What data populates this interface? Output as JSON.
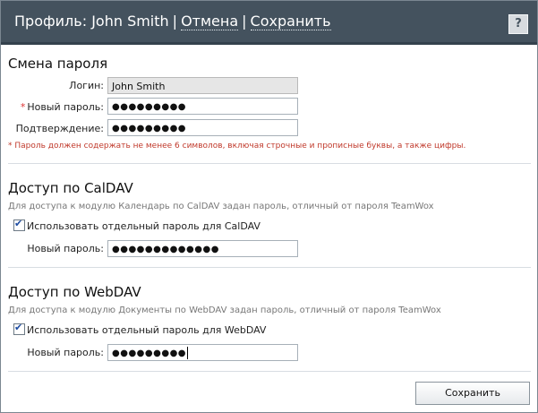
{
  "header": {
    "title": "Профиль: John Smith",
    "separator": "|",
    "cancel_label": "Отмена",
    "save_label": "Сохранить",
    "help_icon_text": "?",
    "background": "#44525e"
  },
  "password_section": {
    "title": "Смена пароля",
    "login_label": "Логин:",
    "login_value": "John Smith",
    "required_mark": "*",
    "new_password_label": "Новый пароль:",
    "new_password_value": "●●●●●●●●●",
    "confirm_label": "Подтверждение:",
    "confirm_value": "●●●●●●●●●",
    "note": "* Пароль должен содержать не менее 6 символов, включая строчные и прописные буквы, а также цифры."
  },
  "caldav_section": {
    "title": "Доступ по CalDAV",
    "description": "Для доступа к модулю Календарь по CalDAV задан пароль, отличный от пароля TeamWox",
    "checkbox_label": "Использовать отдельный пароль для CalDAV",
    "checkbox_checked": true,
    "password_label": "Новый пароль:",
    "password_value": "●●●●●●●●●●●●●"
  },
  "webdav_section": {
    "title": "Доступ по WebDAV",
    "description": "Для доступа к модулю Документы по WebDAV задан пароль, отличный от пароля TeamWox",
    "checkbox_label": "Использовать отдельный пароль для WebDAV",
    "checkbox_checked": true,
    "password_label": "Новый пароль:",
    "password_value": "●●●●●●●●●"
  },
  "footer": {
    "save_button_label": "Сохранить"
  },
  "colors": {
    "note_red": "#c0392b",
    "required_star": "#d33333"
  }
}
